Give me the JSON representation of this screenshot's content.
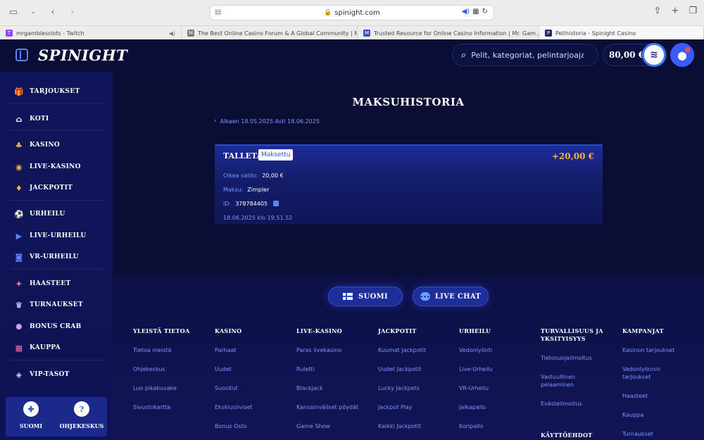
{
  "browser": {
    "url": "spinight.com",
    "tabs": [
      {
        "title": "mrgamblesslots - Twitch",
        "color": "#9146ff",
        "glyph": "T"
      },
      {
        "title": "The Best Online Casino Forum & A Global Community | Mr....",
        "color": "#7b7b7b",
        "glyph": "M"
      },
      {
        "title": "Trusted Resource for Online Casino Information | Mr. Gam...",
        "color": "#3a4ecc",
        "glyph": "M"
      },
      {
        "title": "Pelihistoria - Spinight Casino",
        "color": "#1f2a6d",
        "glyph": "P"
      }
    ]
  },
  "header": {
    "logo": "SPINIGHT",
    "search_placeholder": "Pelit, kategoriat, pelintarjoajat",
    "balance": "80,00 €"
  },
  "sidebar": {
    "items": [
      {
        "label": "TARJOUKSET",
        "icon": "gift-icon",
        "glyph": "🎁"
      },
      {
        "label": "KOTI",
        "icon": "home-icon",
        "glyph": "⌂"
      },
      {
        "label": "KASINO",
        "icon": "casino-icon",
        "glyph": "♣"
      },
      {
        "label": "LIVE-KASINO",
        "icon": "live-casino-icon",
        "glyph": "◉"
      },
      {
        "label": "JACKPOTIT",
        "icon": "jackpot-icon",
        "glyph": "♦"
      },
      {
        "label": "URHEILU",
        "icon": "sports-icon",
        "glyph": "⚽"
      },
      {
        "label": "LIVE-URHEILU",
        "icon": "live-sports-icon",
        "glyph": "▶"
      },
      {
        "label": "VR-URHEILU",
        "icon": "vr-sports-icon",
        "glyph": "◙"
      },
      {
        "label": "HAASTEET",
        "icon": "challenges-icon",
        "glyph": "✦"
      },
      {
        "label": "TURNAUKSET",
        "icon": "trophy-icon",
        "glyph": "♛"
      },
      {
        "label": "BONUS CRAB",
        "icon": "crab-icon",
        "glyph": "✺"
      },
      {
        "label": "KAUPPA",
        "icon": "shop-icon",
        "glyph": "▦"
      },
      {
        "label": "VIP-TASOT",
        "icon": "vip-icon",
        "glyph": "◈"
      }
    ],
    "bottom": [
      {
        "label": "SUOMI",
        "icon": "finland-flag-icon"
      },
      {
        "label": "OHJEKESKUS",
        "icon": "help-icon"
      }
    ]
  },
  "main": {
    "title": "MAKSUHISTORIA",
    "date_range": "Alkaen 18.05.2025 Asti 18.06.2025",
    "transaction": {
      "type": "TALLETA",
      "status": "Maksettu",
      "amount": "+20,00 €",
      "balance_label": "Oikea saldo:",
      "balance_value": "20,00 €",
      "method_label": "Maksu:",
      "method_value": "Zimpler",
      "id_label": "ID:",
      "id_value": "378784405",
      "date": "18.06.2025 klo 19.51.52"
    },
    "language_button": "SUOMI",
    "chat_button": "LIVE CHAT"
  },
  "footer": {
    "columns": [
      {
        "heading": "YLEISTÄ TIETOA",
        "links": [
          "Tietoa meistä",
          "Ohjekeskus",
          "Luo pikakuvake",
          "Sivustokartta"
        ]
      },
      {
        "heading": "KASINO",
        "links": [
          "Parhaat",
          "Uudet",
          "Suositut",
          "Eksklusiiviset",
          "Bonus Osto"
        ]
      },
      {
        "heading": "LIVE-KASINO",
        "links": [
          "Paras livekasino",
          "Ruletti",
          "Blackjack",
          "Kansainväliset pöydät",
          "Game Show"
        ]
      },
      {
        "heading": "JACKPOTIT",
        "links": [
          "Kuumat Jackpotit",
          "Uudet Jackpotit",
          "Lucky Jackpets",
          "Jackpot Play",
          "Kaikki Jackpotit"
        ]
      },
      {
        "heading": "URHEILU",
        "links": [
          "Vedonlyönti",
          "Live-Urheilu",
          "VR-Urheilu",
          "Jalkapallo",
          "Koripallo"
        ]
      },
      {
        "heading": "TURVALLISUUS JA YKSITYISYYS",
        "links": [
          "Tietosuojailmoitus",
          "Vastuullinen pelaaminen",
          "Evästeilmoitus"
        ],
        "extra_heading": "KÄYTTÖEHDOT"
      },
      {
        "heading": "KAMPANJAT",
        "links": [
          "Kasinon tarjoukset",
          "Vedonlyönnin tarjoukset",
          "Haasteet",
          "Kauppa",
          "Turnaukset"
        ]
      }
    ]
  }
}
